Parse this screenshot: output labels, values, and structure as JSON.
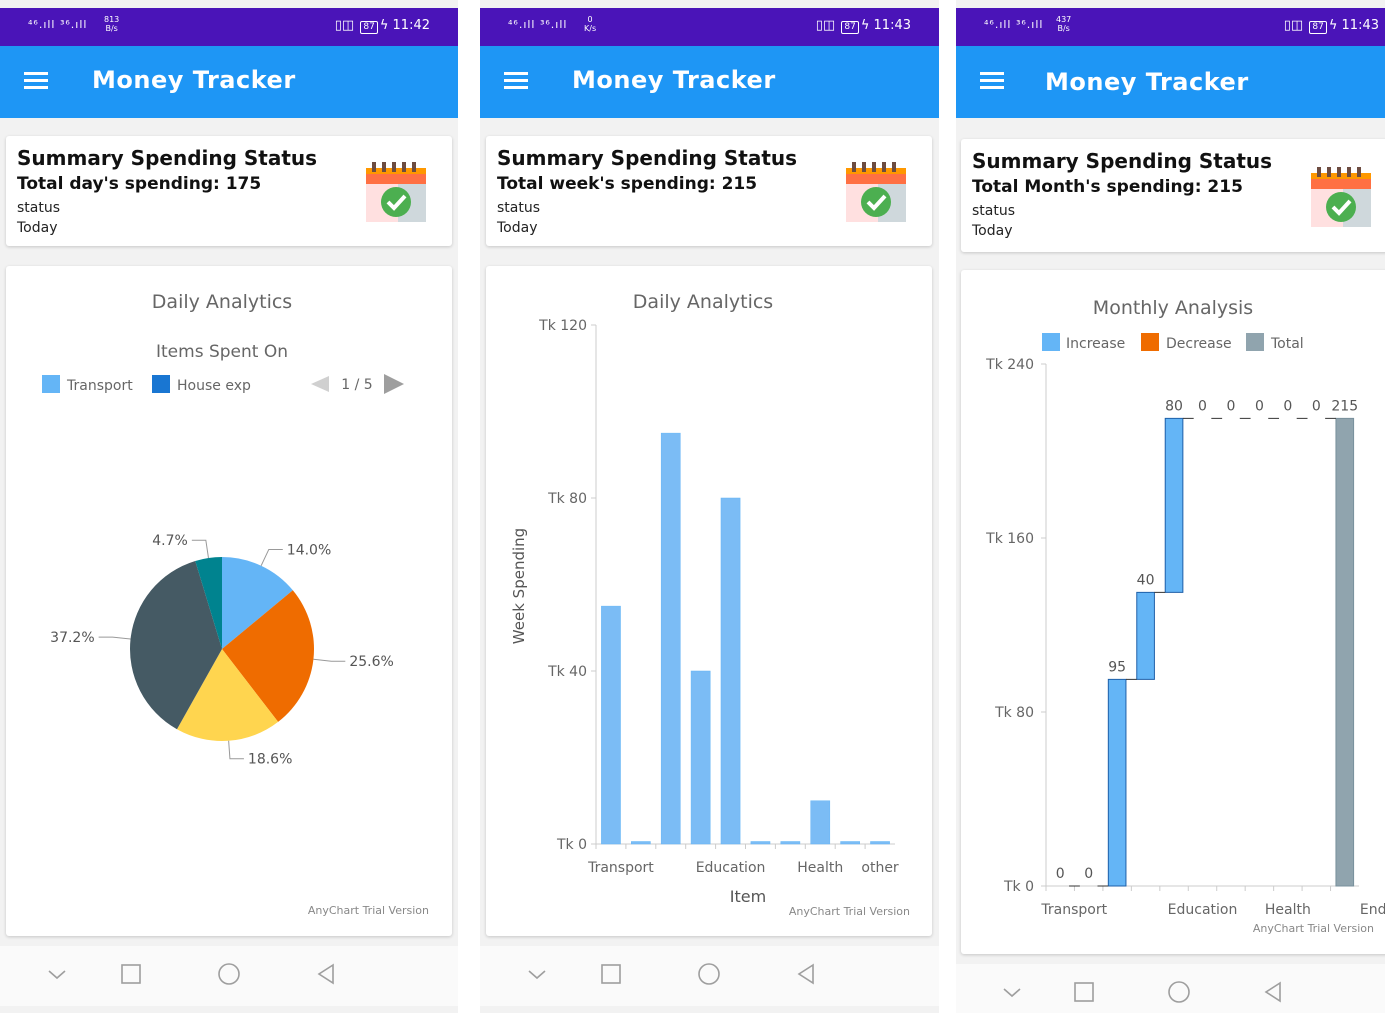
{
  "app": {
    "title": "Money Tracker",
    "accent": "#1e96f5",
    "statusbar_color": "#4a14b8"
  },
  "screens": [
    {
      "statusbar": {
        "signal": "⁴⁶.ıll ³⁶.ıll",
        "speed_value": "813",
        "speed_unit": "B/s",
        "battery": "87",
        "time": "11:42"
      },
      "summary": {
        "title": "Summary Spending Status",
        "total": "Total day's spending: 175",
        "status": "status",
        "period": "Today"
      },
      "chart": {
        "title": "Daily Analytics",
        "subtitle": "Items Spent On",
        "legend": [
          "Transport",
          "House exp"
        ],
        "pager": "1 / 5",
        "watermark": "AnyChart Trial Version"
      }
    },
    {
      "statusbar": {
        "signal": "⁴⁶.ıll ³⁶.ıll",
        "speed_value": "0",
        "speed_unit": "K/s",
        "battery": "87",
        "time": "11:43"
      },
      "summary": {
        "title": "Summary Spending Status",
        "total": "Total week's spending: 215",
        "status": "status",
        "period": "Today"
      },
      "chart": {
        "title": "Daily Analytics",
        "ylabel": "Week Spending",
        "xlabel": "Item",
        "watermark": "AnyChart Trial Version"
      }
    },
    {
      "statusbar": {
        "signal": "⁴⁶.ıll ³⁶.ıll",
        "speed_value": "437",
        "speed_unit": "B/s",
        "battery": "87",
        "time": "11:43"
      },
      "summary": {
        "title": "Summary Spending Status",
        "total": "Total Month's spending: 215",
        "status": "status",
        "period": "Today"
      },
      "chart": {
        "title": "Monthly Analysis",
        "legend": [
          "Increase",
          "Decrease",
          "Total"
        ],
        "watermark": "AnyChart Trial Version"
      }
    }
  ],
  "chart_data": [
    {
      "type": "pie",
      "title": "Daily Analytics",
      "subtitle": "Items Spent On",
      "slices": [
        {
          "label": "14.0%",
          "value": 14.0,
          "color": "#64b5f6"
        },
        {
          "label": "25.6%",
          "value": 25.6,
          "color": "#ef6c00"
        },
        {
          "label": "18.6%",
          "value": 18.6,
          "color": "#ffd54f"
        },
        {
          "label": "37.2%",
          "value": 37.2,
          "color": "#455a64"
        },
        {
          "label": "4.7%",
          "value": 4.7,
          "color": "#00838f"
        }
      ],
      "legend": [
        "Transport",
        "House exp"
      ],
      "colors": {
        "transport": "#64b5f6",
        "house_exp": "#1976d2"
      }
    },
    {
      "type": "bar",
      "title": "Daily Analytics",
      "xlabel": "Item",
      "ylabel": "Week Spending",
      "ylim": [
        0,
        120
      ],
      "yticks": [
        "Tk 0",
        "Tk 40",
        "Tk 80",
        "Tk 120"
      ],
      "categories": [
        "Transport",
        "",
        "",
        "",
        "Education",
        "",
        "",
        "Health",
        "",
        "other"
      ],
      "xtick_labels": [
        "Transport",
        "Education",
        "Health",
        "other"
      ],
      "values": [
        55,
        0,
        95,
        40,
        80,
        0,
        0,
        10,
        0,
        0
      ],
      "color": "#7bbcf5"
    },
    {
      "type": "bar",
      "subtype": "waterfall",
      "title": "Monthly Analysis",
      "ylim": [
        0,
        240
      ],
      "yticks": [
        "Tk 0",
        "Tk 80",
        "Tk 160",
        "Tk 240"
      ],
      "categories": [
        "Transport",
        "",
        "",
        "",
        "",
        "Education",
        "",
        "",
        "Health",
        "",
        "",
        "End"
      ],
      "xtick_labels": [
        "Transport",
        "Education",
        "Health",
        "End"
      ],
      "values": [
        0,
        0,
        95,
        40,
        80,
        0,
        0,
        0,
        0,
        0,
        215
      ],
      "labels": [
        "0",
        "0",
        "95",
        "40",
        "80",
        "0",
        "0",
        "0",
        "0",
        "0",
        "215"
      ],
      "legend": [
        "Increase",
        "Decrease",
        "Total"
      ],
      "colors": {
        "increase": "#64b5f6",
        "decrease": "#ef6c00",
        "total": "#90a4ae"
      }
    }
  ]
}
